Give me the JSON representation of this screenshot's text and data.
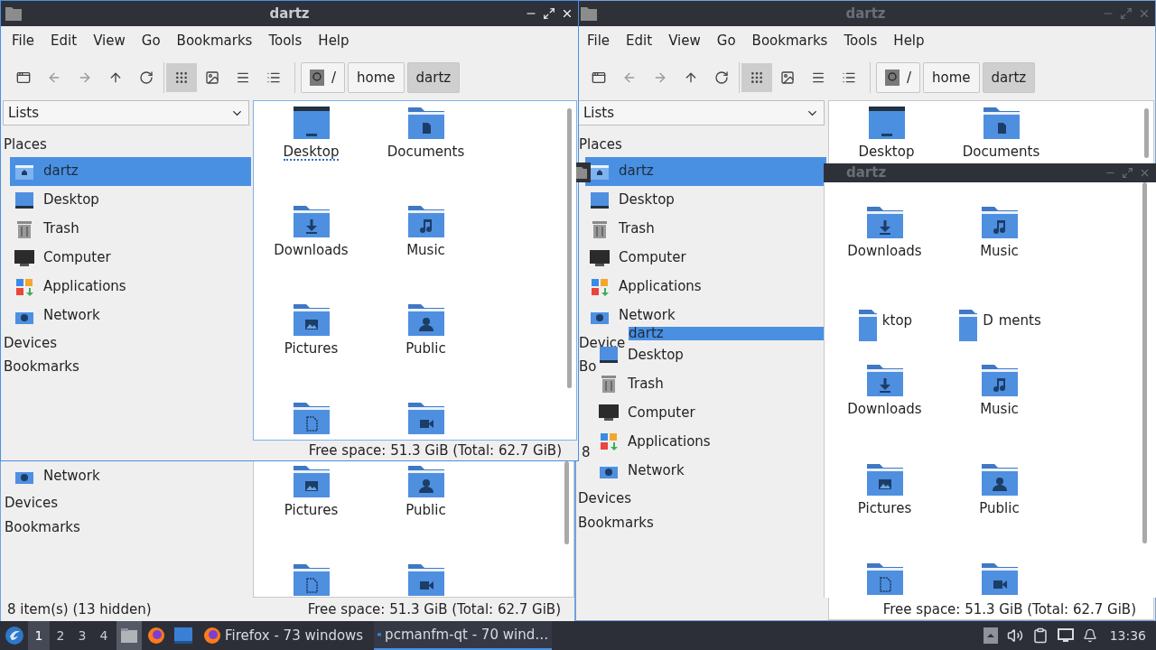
{
  "front_window": {
    "title": "dartz",
    "active": true,
    "menu": [
      "File",
      "Edit",
      "View",
      "Go",
      "Bookmarks",
      "Tools",
      "Help"
    ],
    "views": [
      {
        "kind": "icons",
        "selected": true
      },
      {
        "kind": "thumbnails",
        "selected": false
      },
      {
        "kind": "compact",
        "selected": false
      },
      {
        "kind": "details",
        "selected": false
      }
    ],
    "path": [
      {
        "label": "/",
        "kind": "root",
        "selected": false
      },
      {
        "label": "home",
        "kind": "dir",
        "selected": false
      },
      {
        "label": "dartz",
        "kind": "dir",
        "selected": true
      }
    ],
    "side_pane": "Lists",
    "places_heading": "Places",
    "places": [
      {
        "label": "dartz",
        "kind": "home",
        "selected": true
      },
      {
        "label": "Desktop",
        "kind": "desktop",
        "selected": false
      },
      {
        "label": "Trash",
        "kind": "trash",
        "selected": false
      },
      {
        "label": "Computer",
        "kind": "computer",
        "selected": false
      },
      {
        "label": "Applications",
        "kind": "applications",
        "selected": false
      },
      {
        "label": "Network",
        "kind": "network",
        "selected": false
      }
    ],
    "devices": "Devices",
    "bookmarks": "Bookmarks",
    "files": [
      {
        "label": "Desktop",
        "kind": "desktop",
        "focused": true
      },
      {
        "label": "Documents",
        "kind": "documents",
        "focused": false
      },
      {
        "label": "Downloads",
        "kind": "downloads",
        "focused": false
      },
      {
        "label": "Music",
        "kind": "music",
        "focused": false
      },
      {
        "label": "Pictures",
        "kind": "pictures",
        "focused": false
      },
      {
        "label": "Public",
        "kind": "public",
        "focused": false
      },
      {
        "kind": "templates"
      },
      {
        "kind": "videos"
      }
    ],
    "free_space": "Free space: 51.3 GiB (Total: 62.7 GiB)"
  },
  "back_window": {
    "places": [
      {
        "label": "Network",
        "kind": "network",
        "selected": false
      }
    ],
    "devices": "Devices",
    "bookmarks": "Bookmarks",
    "files": [
      {
        "label": "Pictures",
        "kind": "pictures"
      },
      {
        "label": "Public",
        "kind": "public"
      },
      {
        "kind": "templates"
      },
      {
        "kind": "videos"
      }
    ],
    "item_count": "8 item(s) (13 hidden)",
    "free_space": "Free space: 51.3 GiB (Total: 62.7 GiB)"
  },
  "right_window": {
    "title": "dartz",
    "active": false,
    "menu": [
      "File",
      "Edit",
      "View",
      "Go",
      "Bookmarks",
      "Tools",
      "Help"
    ],
    "views": [
      {
        "kind": "icons",
        "selected": true
      },
      {
        "kind": "thumbnails",
        "selected": false
      },
      {
        "kind": "compact",
        "selected": false
      },
      {
        "kind": "details",
        "selected": false
      }
    ],
    "path": [
      {
        "label": "/",
        "kind": "root",
        "selected": false
      },
      {
        "label": "home",
        "kind": "dir",
        "selected": false
      },
      {
        "label": "dartz",
        "kind": "dir",
        "selected": true
      }
    ],
    "side_pane": "Lists",
    "places_heading": "Places",
    "places": [
      {
        "label": "dartz",
        "kind": "home",
        "selected": true
      },
      {
        "label": "Desktop",
        "kind": "desktop",
        "selected": false
      },
      {
        "label": "Trash",
        "kind": "trash",
        "selected": false
      },
      {
        "label": "Computer",
        "kind": "computer",
        "selected": false
      },
      {
        "label": "Applications",
        "kind": "applications",
        "selected": false
      },
      {
        "label": "Network",
        "kind": "network",
        "selected": false
      }
    ],
    "devices": "Device",
    "bookmarks": "Bo",
    "files": [
      {
        "label": "Desktop",
        "kind": "desktop"
      },
      {
        "label": "Documents",
        "kind": "documents"
      }
    ],
    "stray_text": "8"
  },
  "overlay_window": {
    "title": "dartz",
    "places": [
      {
        "label": "dartz",
        "selected": true
      },
      {
        "label": "Desktop",
        "kind": "desktop",
        "selected": false
      },
      {
        "label": "Trash",
        "kind": "trash",
        "selected": false
      },
      {
        "label": "Computer",
        "kind": "computer",
        "selected": false
      },
      {
        "label": "Applications",
        "kind": "applications",
        "selected": false
      },
      {
        "label": "Network",
        "kind": "network",
        "selected": false
      }
    ],
    "devices": "Devices",
    "bookmarks": "Bookmarks",
    "files": [
      {
        "label": "Downloads",
        "kind": "downloads"
      },
      {
        "label": "Music",
        "kind": "music"
      },
      {
        "kind": "glitch",
        "texts": [
          "ktop"
        ]
      },
      {
        "kind": "glitch",
        "texts": [
          "D",
          "ments"
        ]
      },
      {
        "label": "Downloads",
        "kind": "downloads"
      },
      {
        "label": "Music",
        "kind": "music"
      },
      {
        "label": "Pictures",
        "kind": "pictures"
      },
      {
        "label": "Public",
        "kind": "public"
      },
      {
        "kind": "templates"
      },
      {
        "kind": "videos"
      }
    ],
    "free_space": "Free space: 51.3 GiB (Total: 62.7 GiB)"
  },
  "taskbar": {
    "workspaces": [
      {
        "label": "1",
        "selected": true
      },
      {
        "label": "2",
        "selected": false
      },
      {
        "label": "3",
        "selected": false
      },
      {
        "label": "4",
        "selected": false
      }
    ],
    "tasks": [
      {
        "label": "Firefox - 73 windows",
        "kind": "firefox",
        "selected": false
      },
      {
        "label": "pcmanfm-qt - 70 wind…",
        "kind": "files",
        "selected": true
      }
    ],
    "clock": "13:36"
  }
}
